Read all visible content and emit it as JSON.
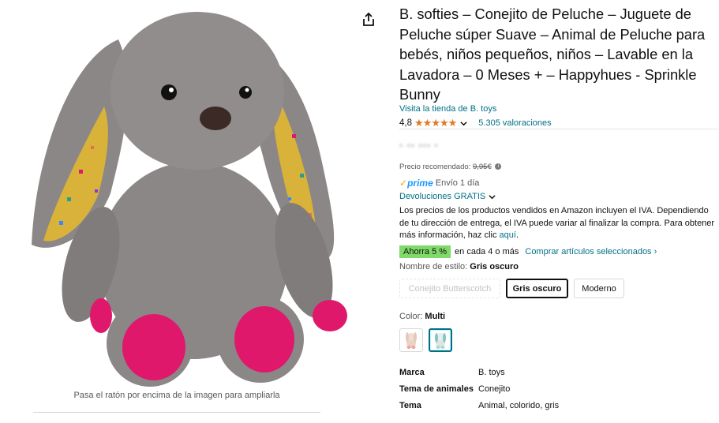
{
  "image_panel": {
    "hover_hint": "Pasa el ratón por encima de la imagen para ampliarla"
  },
  "product": {
    "title": "B. softies – Conejito de Peluche – Juguete de Peluche súper Suave – Animal de Peluche para bebés, niños pequeños, niños – Lavable en la Lavadora – 0 Meses + – Happyhues - Sprinkle Bunny",
    "store_link": "Visita la tienda de B. toys",
    "rating": "4,8",
    "stars": 4.8,
    "reviews": "5.305 valoraciones"
  },
  "pricing": {
    "recommended_label": "Precio recomendado:",
    "recommended_value": "9,95€",
    "prime_label": "prime",
    "shipping": "Envío 1 día",
    "returns": "Devoluciones GRATIS",
    "vat_note": "Los precios de los productos vendidos en Amazon incluyen el IVA. Dependiendo de tu dirección de entrega, el IVA puede variar al finalizar la compra. Para obtener más información, haz clic ",
    "vat_link": "aquí",
    "vat_end": "."
  },
  "promo": {
    "badge": "Ahorra 5 %",
    "text": "en cada 4 o más",
    "link": "Comprar artículos seleccionados ›"
  },
  "style": {
    "label": "Nombre de estilo: ",
    "selected": "Gris oscuro",
    "options": [
      {
        "label": "Conejito Butterscotch"
      },
      {
        "label": "Gris oscuro"
      },
      {
        "label": "Moderno"
      }
    ]
  },
  "color": {
    "label": "Color: ",
    "selected": "Multi"
  },
  "specs": [
    {
      "key": "Marca",
      "value": "B. toys"
    },
    {
      "key": "Tema de animales",
      "value": "Conejito"
    },
    {
      "key": "Tema",
      "value": "Animal, colorido, gris"
    }
  ],
  "colors": {
    "link": "#007185",
    "star": "#de7921",
    "prime": "#1a98ff",
    "badge": "#7fda69",
    "plush_grey": "#8b8786",
    "ear_yellow": "#d9b23a",
    "paw_pink": "#e0186b"
  }
}
